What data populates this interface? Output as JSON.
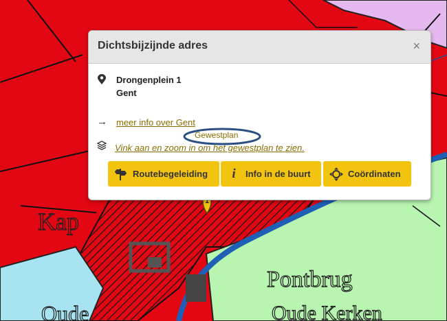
{
  "popup": {
    "title": "Dichtsbijzijnde adres",
    "close_label": "×",
    "address_line1": "Drongenplein 1",
    "address_line2": "Gent",
    "more_info_link": "meer info over Gent",
    "gewestplan_label": "Gewestplan",
    "gewestplan_link": "Vink aan en zoom in om het gewestplan te zien.",
    "buttons": [
      {
        "label": "Routebegeleiding",
        "icon": "route-sign-icon"
      },
      {
        "label": "Info in de buurt",
        "icon": "info-icon"
      },
      {
        "label": "Coördinaten",
        "icon": "crosshair-icon"
      }
    ]
  },
  "map": {
    "place_labels": [
      "Kap",
      "Pontbrug",
      "Oude",
      "Oude Kerken"
    ],
    "marker_number": "1"
  },
  "colors": {
    "map_red": "#e30613",
    "map_green": "#b8f5b0",
    "map_blue_water": "#a8e3f2",
    "map_lilac": "#e5b8ef",
    "accent_yellow": "#f2c30f",
    "link_color": "#8a6d00",
    "annotation_blue": "#2b4f82"
  }
}
